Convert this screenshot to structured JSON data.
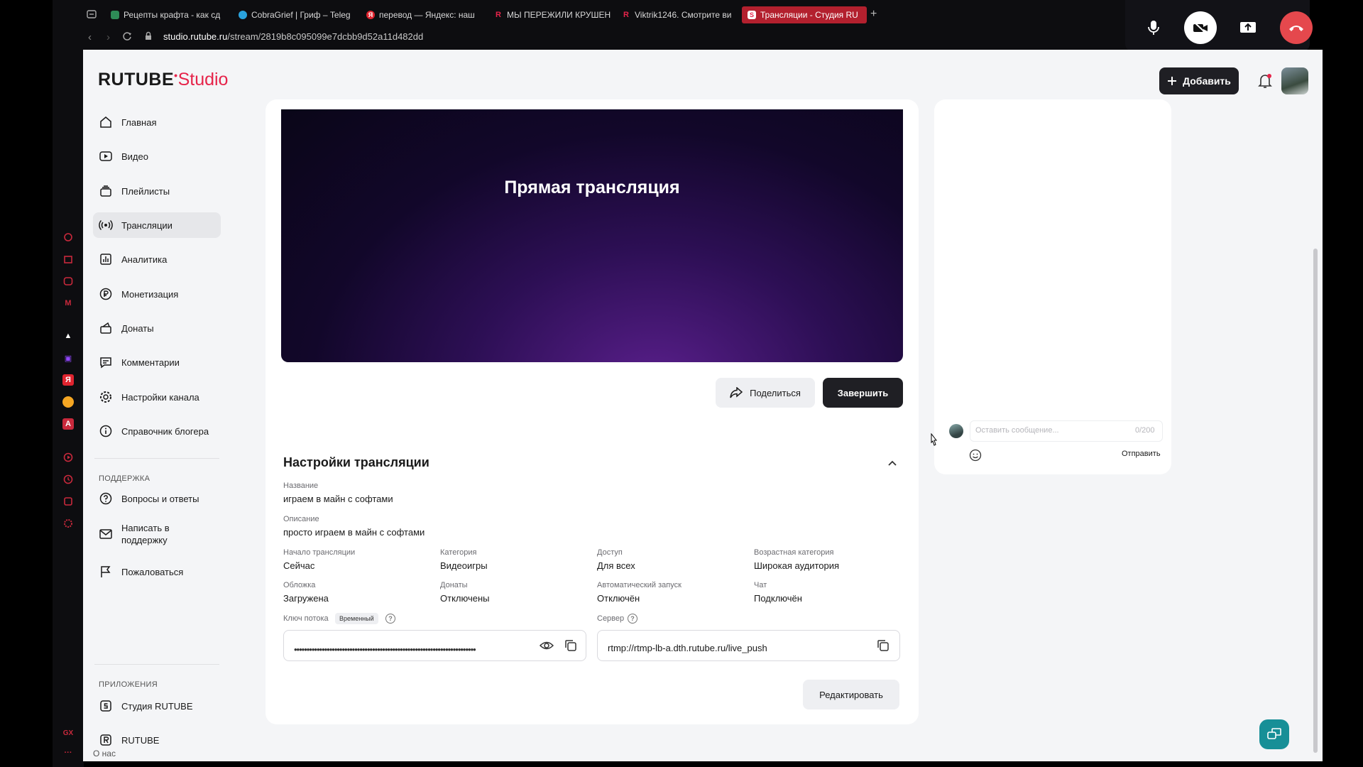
{
  "browser": {
    "tabs": [
      {
        "label": "Рецепты крафта - как сд",
        "color": "#2e8b57",
        "glyph": ""
      },
      {
        "label": "CobraGrief | Гриф – Teleg",
        "color": "#2aa3de",
        "glyph": ""
      },
      {
        "label": "перевод — Яндекс: наш",
        "color": "#e0242f",
        "glyph": "Я"
      },
      {
        "label": "МЫ ПЕРЕЖИЛИ КРУШЕН",
        "color": "#e6244a",
        "glyph": "R"
      },
      {
        "label": "Viktrik1246. Смотрите ви",
        "color": "#e6244a",
        "glyph": "R"
      },
      {
        "label": "Трансляции - Студия RU",
        "color": "#e6244a",
        "glyph": "S"
      }
    ],
    "url_host": "studio.rutube.ru",
    "url_path": "/stream/2819b8c095099e7dcbb9d52a11d482dd"
  },
  "app": {
    "logo_main": "RUTUBE",
    "logo_studio": "Studio",
    "add_label": "Добавить"
  },
  "sidebar": {
    "items": [
      {
        "label": "Главная",
        "icon": "home-icon"
      },
      {
        "label": "Видео",
        "icon": "video-icon"
      },
      {
        "label": "Плейлисты",
        "icon": "playlist-icon"
      },
      {
        "label": "Трансляции",
        "icon": "broadcast-icon"
      },
      {
        "label": "Аналитика",
        "icon": "analytics-icon"
      },
      {
        "label": "Монетизация",
        "icon": "ruble-icon"
      },
      {
        "label": "Донаты",
        "icon": "donate-icon"
      },
      {
        "label": "Комментарии",
        "icon": "comment-icon"
      },
      {
        "label": "Настройки канала",
        "icon": "gear-icon"
      },
      {
        "label": "Справочник блогера",
        "icon": "info-icon"
      }
    ],
    "support_title": "ПОДДЕРЖКА",
    "support": [
      {
        "label": "Вопросы и ответы",
        "icon": "question-icon"
      },
      {
        "label": "Написать в поддержку",
        "icon": "mail-icon"
      },
      {
        "label": "Пожаловаться",
        "icon": "flag-icon"
      }
    ],
    "apps_title": "ПРИЛОЖЕНИЯ",
    "apps": [
      {
        "label": "Студия RUTUBE",
        "icon": "studio-icon"
      },
      {
        "label": "RUTUBE",
        "icon": "rutube-icon"
      }
    ],
    "about": "О нас"
  },
  "player": {
    "title": "Прямая трансляция",
    "share": "Поделиться",
    "end": "Завершить"
  },
  "settings": {
    "title": "Настройки трансляции",
    "name_label": "Название",
    "name_value": "играем в майн с софтами",
    "desc_label": "Описание",
    "desc_value": "просто играем в майн с софтами",
    "start_label": "Начало трансляции",
    "start_value": "Сейчас",
    "category_label": "Категория",
    "category_value": "Видеоигры",
    "access_label": "Доступ",
    "access_value": "Для всех",
    "age_label": "Возрастная категория",
    "age_value": "Широкая аудитория",
    "cover_label": "Обложка",
    "cover_value": "Загружена",
    "donations_label": "Донаты",
    "donations_value": "Отключены",
    "autostart_label": "Автоматический запуск",
    "autostart_value": "Отключён",
    "chat_label": "Чат",
    "chat_value": "Подключён",
    "key_label": "Ключ потока",
    "key_tag": "Временный",
    "key_value": "••••••••••••••••••••••••••••••••••••••••••••••••••••••••••••••••••••••••",
    "server_label": "Сервер",
    "server_value": "rtmp://rtmp-lb-a.dth.rutube.ru/live_push",
    "edit": "Редактировать"
  },
  "chat": {
    "placeholder": "Оставить сообщение...",
    "counter": "0/200",
    "send": "Отправить"
  },
  "colors": {
    "accent": "#e6244a",
    "dark_button": "#1f1f24",
    "teal": "#178f97"
  }
}
